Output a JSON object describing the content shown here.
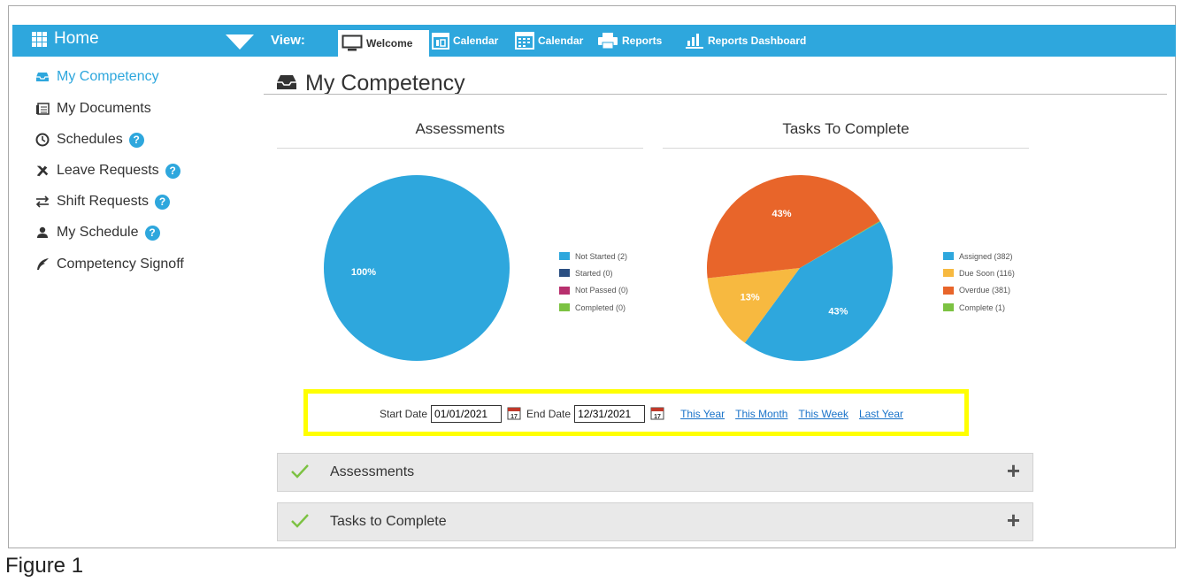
{
  "nav": {
    "home_label": "Home",
    "view_label": "View:",
    "tabs": [
      {
        "label": "Welcome",
        "icon": "monitor-icon"
      },
      {
        "label": "Calendar",
        "icon": "calendar-icon"
      },
      {
        "label": "Calendar",
        "icon": "calendar-grid-icon"
      },
      {
        "label": "Reports",
        "icon": "printer-icon"
      },
      {
        "label": "Reports Dashboard",
        "icon": "bar-chart-icon"
      }
    ]
  },
  "sidebar": {
    "items": [
      {
        "label": "My Competency",
        "icon": "inbox-icon",
        "help": false,
        "active": true
      },
      {
        "label": "My Documents",
        "icon": "documents-icon",
        "help": false
      },
      {
        "label": "Schedules",
        "icon": "clock-icon",
        "help": true
      },
      {
        "label": "Leave Requests",
        "icon": "plane-icon",
        "help": true
      },
      {
        "label": "Shift Requests",
        "icon": "swap-arrows-icon",
        "help": true
      },
      {
        "label": "My Schedule",
        "icon": "user-icon",
        "help": true
      },
      {
        "label": "Competency Signoff",
        "icon": "feather-icon",
        "help": false
      }
    ]
  },
  "page": {
    "title": "My Competency"
  },
  "chart_data": [
    {
      "type": "pie",
      "title": "Assessments",
      "series": [
        {
          "name": "Not Started",
          "value": 2,
          "color": "#2ea7dd"
        },
        {
          "name": "Started",
          "value": 0,
          "color": "#2b4f82"
        },
        {
          "name": "Not Passed",
          "value": 0,
          "color": "#b8306e"
        },
        {
          "name": "Completed",
          "value": 0,
          "color": "#7cc242"
        }
      ],
      "legend": [
        "Not Started (2)",
        "Started (0)",
        "Not Passed (0)",
        "Completed (0)"
      ],
      "slice_labels": [
        "100%"
      ],
      "legend_position": "right"
    },
    {
      "type": "pie",
      "title": "Tasks To Complete",
      "series": [
        {
          "name": "Assigned",
          "value": 382,
          "color": "#2ea7dd"
        },
        {
          "name": "Due Soon",
          "value": 116,
          "color": "#f7b940"
        },
        {
          "name": "Overdue",
          "value": 381,
          "color": "#e8652a"
        },
        {
          "name": "Complete",
          "value": 1,
          "color": "#7cc242"
        }
      ],
      "legend": [
        "Assigned (382)",
        "Due Soon (116)",
        "Overdue (381)",
        "Complete (1)"
      ],
      "slice_labels": [
        "43%",
        "13%",
        "43%"
      ],
      "legend_position": "right"
    }
  ],
  "filters": {
    "start_label": "Start Date",
    "start_value": "01/01/2021",
    "end_label": "End Date",
    "end_value": "12/31/2021",
    "links": [
      "This Year",
      "This Month",
      "This Week",
      "Last Year"
    ]
  },
  "panels": [
    {
      "title": "Assessments"
    },
    {
      "title": "Tasks to Complete"
    }
  ],
  "caption": "Figure 1"
}
